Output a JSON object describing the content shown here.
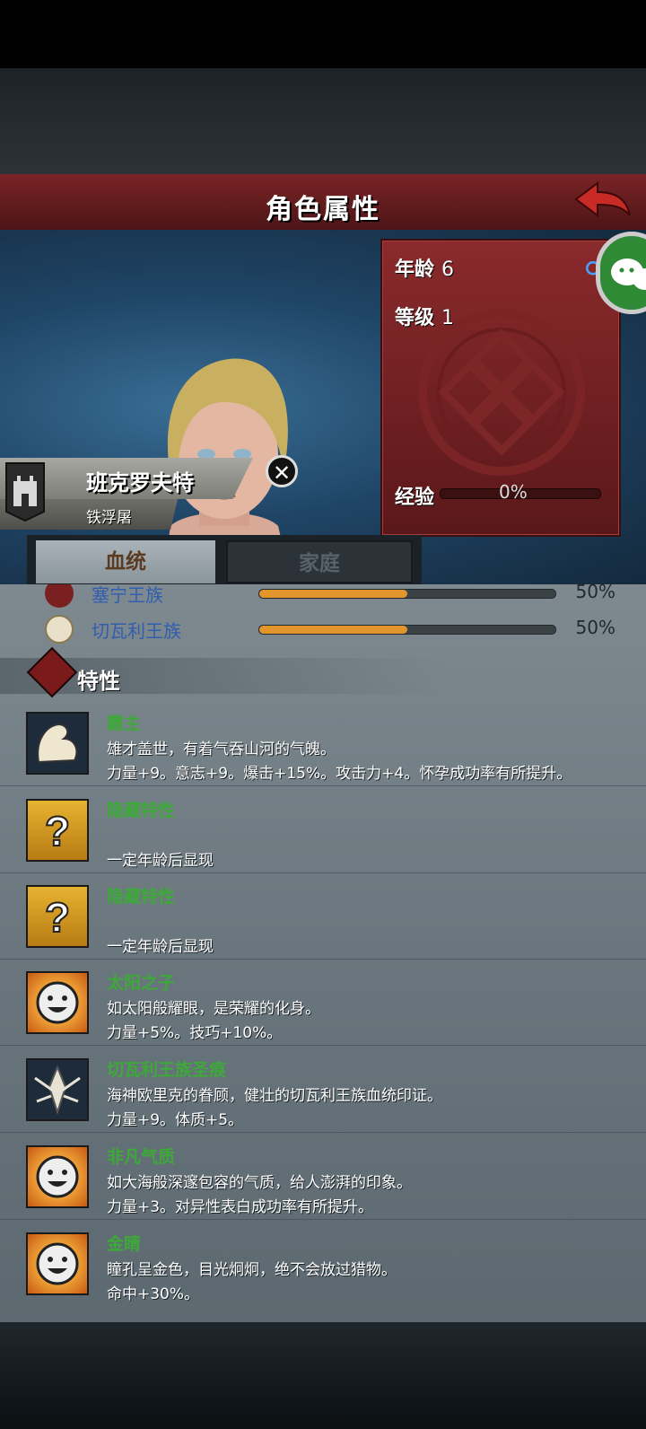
{
  "header": {
    "title": "角色属性"
  },
  "stats": {
    "age_label": "年龄",
    "age_value": "6",
    "level_label": "等级",
    "level_value": "1",
    "gender_icon": "male-symbol-icon",
    "exp_label": "经验",
    "exp_value": "0%",
    "exp_progress": 0
  },
  "character": {
    "name": "班克罗夫特",
    "house": "铁浮屠"
  },
  "tabs": [
    {
      "label": "血统",
      "active": true
    },
    {
      "label": "家庭",
      "active": false
    }
  ],
  "lineage": [
    {
      "name": "塞宁王族",
      "percent": "50%",
      "progress": 0.5
    },
    {
      "name": "切瓦利王族",
      "percent": "50%",
      "progress": 0.5
    }
  ],
  "traits_title": "特性",
  "traits": [
    {
      "name": "霸主",
      "desc": "雄才盖世，有着气吞山河的气魄。",
      "effect": "力量+9。意志+9。爆击+15%。攻击力+4。怀孕成功率有所提升。",
      "icon": "flexed-arm-icon"
    },
    {
      "name": "隐藏特性",
      "desc": "",
      "effect": "一定年龄后显现",
      "icon": "question-mark-icon"
    },
    {
      "name": "隐藏特性",
      "desc": "",
      "effect": "一定年龄后显现",
      "icon": "question-mark-icon"
    },
    {
      "name": "太阳之子",
      "desc": "如太阳般耀眼，是荣耀的化身。",
      "effect": "力量+5%。技巧+10%。",
      "icon": "smiley-face-icon"
    },
    {
      "name": "切瓦利王族圣痕",
      "desc": "海神欧里克的眷顾，健壮的切瓦利王族血统印证。",
      "effect": "力量+9。体质+5。",
      "icon": "stigmata-emblem-icon"
    },
    {
      "name": "非凡气质",
      "desc": "如大海般深邃包容的气质，给人澎湃的印象。",
      "effect": "力量+3。对异性表白成功率有所提升。",
      "icon": "smiley-face-icon"
    },
    {
      "name": "金睛",
      "desc": "瞳孔呈金色，目光炯炯，绝不会放过猎物。",
      "effect": "命中+30%。",
      "icon": "smiley-face-icon"
    }
  ]
}
